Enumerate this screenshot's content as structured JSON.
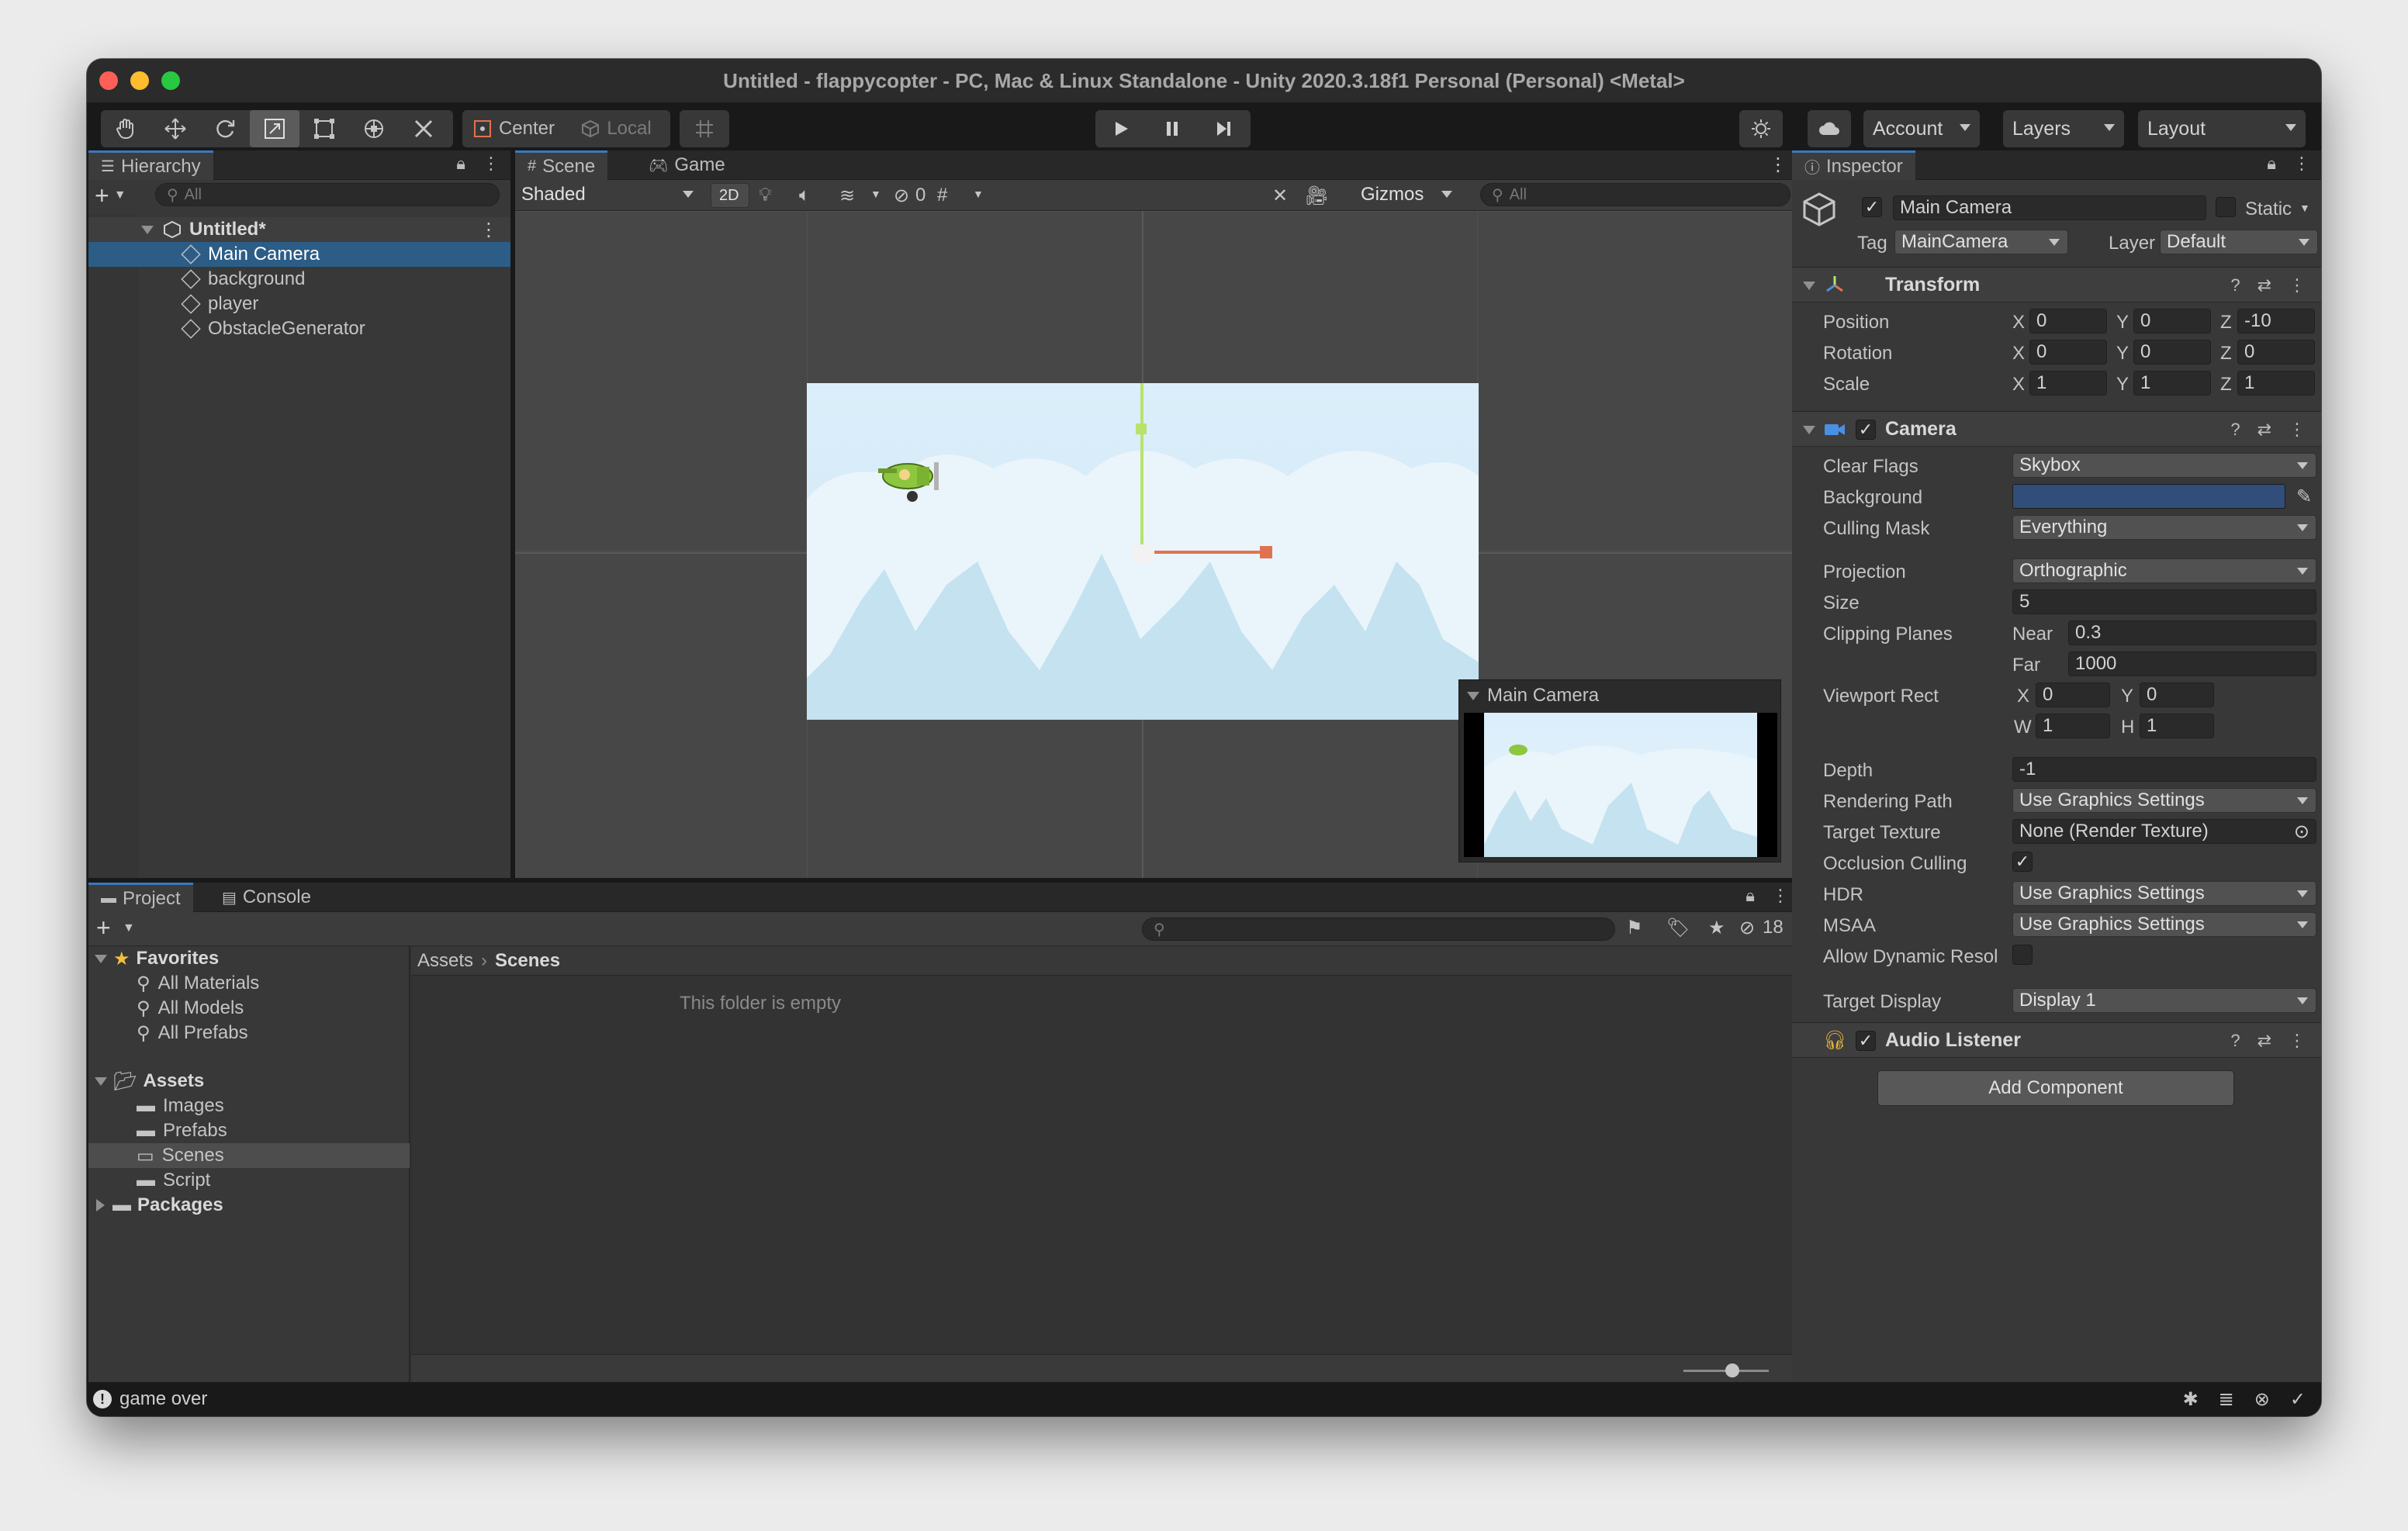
{
  "window": {
    "title": "Untitled - flappycopter - PC, Mac & Linux Standalone - Unity 2020.3.18f1 Personal (Personal) <Metal>"
  },
  "toolbar": {
    "pivot_mode": "Center",
    "pivot_rotation": "Local",
    "account_label": "Account",
    "layers_label": "Layers",
    "layout_label": "Layout"
  },
  "hierarchy": {
    "tab_label": "Hierarchy",
    "search_placeholder": "All",
    "scene_name": "Untitled*",
    "objects": [
      "Main Camera",
      "background",
      "player",
      "ObstacleGenerator"
    ]
  },
  "scene_view": {
    "tabs": [
      "Scene",
      "Game"
    ],
    "shading_mode": "Shaded",
    "mode_2d_label": "2D",
    "hidden_count": "0",
    "gizmos_label": "Gizmos",
    "search_placeholder": "All",
    "camera_preview_title": "Main Camera"
  },
  "project": {
    "tabs": [
      "Project",
      "Console"
    ],
    "hidden_count": "18",
    "favorites_label": "Favorites",
    "favorites": [
      "All Materials",
      "All Models",
      "All Prefabs"
    ],
    "assets_label": "Assets",
    "asset_folders": [
      "Images",
      "Prefabs",
      "Scenes",
      "Script"
    ],
    "packages_label": "Packages",
    "breadcrumb": [
      "Assets",
      "Scenes"
    ],
    "empty_message": "This folder is empty"
  },
  "inspector": {
    "tab_label": "Inspector",
    "object_name": "Main Camera",
    "static_label": "Static",
    "tag_label": "Tag",
    "tag_value": "MainCamera",
    "layer_label": "Layer",
    "layer_value": "Default",
    "transform": {
      "title": "Transform",
      "rows": [
        {
          "label": "Position",
          "x": "0",
          "y": "0",
          "z": "-10"
        },
        {
          "label": "Rotation",
          "x": "0",
          "y": "0",
          "z": "0"
        },
        {
          "label": "Scale",
          "x": "1",
          "y": "1",
          "z": "1"
        }
      ]
    },
    "camera": {
      "title": "Camera",
      "clear_flags_label": "Clear Flags",
      "clear_flags_value": "Skybox",
      "background_label": "Background",
      "background_color": "#314d79",
      "culling_mask_label": "Culling Mask",
      "culling_mask_value": "Everything",
      "projection_label": "Projection",
      "projection_value": "Orthographic",
      "size_label": "Size",
      "size_value": "5",
      "clipping_label": "Clipping Planes",
      "near_label": "Near",
      "near_value": "0.3",
      "far_label": "Far",
      "far_value": "1000",
      "viewport_label": "Viewport Rect",
      "viewport_x": "0",
      "viewport_y": "0",
      "viewport_w": "1",
      "viewport_h": "1",
      "depth_label": "Depth",
      "depth_value": "-1",
      "rendering_path_label": "Rendering Path",
      "rendering_path_value": "Use Graphics Settings",
      "target_texture_label": "Target Texture",
      "target_texture_value": "None (Render Texture)",
      "occlusion_label": "Occlusion Culling",
      "hdr_label": "HDR",
      "hdr_value": "Use Graphics Settings",
      "msaa_label": "MSAA",
      "msaa_value": "Use Graphics Settings",
      "dynamic_res_label": "Allow Dynamic Resol",
      "target_display_label": "Target Display",
      "target_display_value": "Display 1"
    },
    "audio_listener_title": "Audio Listener",
    "add_component_label": "Add Component"
  },
  "status_bar": {
    "message": "game over"
  }
}
